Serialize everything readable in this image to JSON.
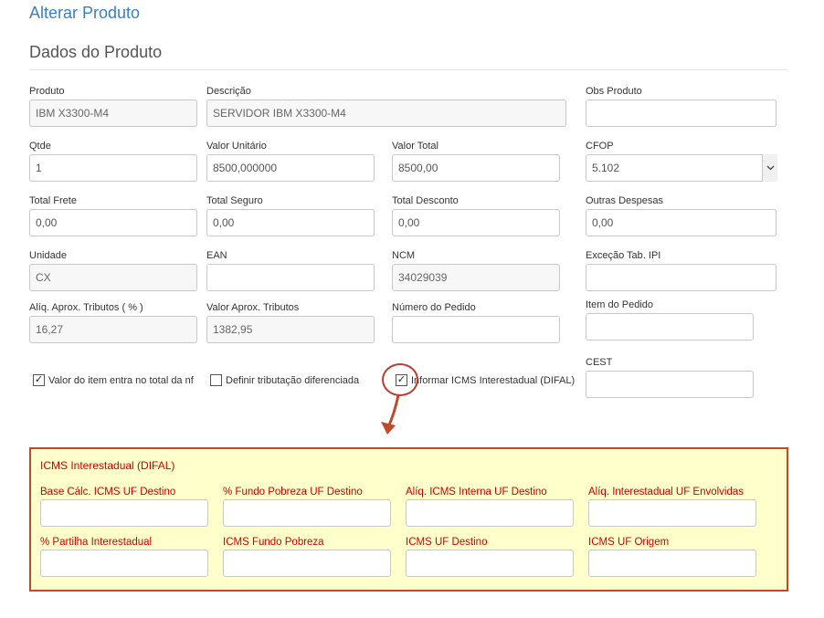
{
  "page": {
    "title": "Alterar Produto",
    "section": "Dados do Produto"
  },
  "fields": {
    "produto": {
      "label": "Produto",
      "value": "IBM X3300-M4"
    },
    "descricao": {
      "label": "Descrição",
      "value": "SERVIDOR IBM X3300-M4"
    },
    "obs_produto": {
      "label": "Obs Produto",
      "value": ""
    },
    "qtde": {
      "label": "Qtde",
      "value": "1"
    },
    "valor_unitario": {
      "label": "Valor Unitário",
      "value": "8500,000000"
    },
    "valor_total": {
      "label": "Valor Total",
      "value": "8500,00"
    },
    "cfop": {
      "label": "CFOP",
      "value": "5.102"
    },
    "total_frete": {
      "label": "Total Frete",
      "value": "0,00"
    },
    "total_seguro": {
      "label": "Total Seguro",
      "value": "0,00"
    },
    "total_desconto": {
      "label": "Total Desconto",
      "value": "0,00"
    },
    "outras_despesas": {
      "label": "Outras Despesas",
      "value": "0,00"
    },
    "unidade": {
      "label": "Unidade",
      "value": "CX"
    },
    "ean": {
      "label": "EAN",
      "value": ""
    },
    "ncm": {
      "label": "NCM",
      "value": "34029039"
    },
    "excecao_ipi": {
      "label": "Exceção Tab. IPI",
      "value": ""
    },
    "aliq_aprox": {
      "label": "Alíq. Aprox. Tributos ( % )",
      "value": "16,27"
    },
    "valor_aprox": {
      "label": "Valor Aprox. Tributos",
      "value": "1382,95"
    },
    "numero_pedido": {
      "label": "Número do Pedido",
      "value": ""
    },
    "item_pedido": {
      "label": "Item do Pedido",
      "value": ""
    },
    "cest": {
      "label": "CEST",
      "value": ""
    }
  },
  "checkboxes": {
    "valor_total_nf": {
      "label": "Valor do item entra no total da nf",
      "checked": true
    },
    "tributacao_diferenciada": {
      "label": "Definir tributação diferenciada",
      "checked": false
    },
    "icms_difal": {
      "label": "Informar ICMS Interestadual (DIFAL)",
      "checked": true
    }
  },
  "difal": {
    "title": "ICMS Interestadual (DIFAL)",
    "base_calc": {
      "label": "Base Cálc. ICMS UF Destino",
      "value": ""
    },
    "fundo_pobreza_pct": {
      "label": "% Fundo Pobreza UF Destino",
      "value": ""
    },
    "aliq_interna": {
      "label": "Alíq. ICMS Interna UF Destino",
      "value": ""
    },
    "aliq_interestadual": {
      "label": "Alíq. Interestadual UF Envolvidas",
      "value": ""
    },
    "partilha": {
      "label": "% Partilha Interestadual",
      "value": ""
    },
    "fundo_pobreza": {
      "label": "ICMS Fundo Pobreza",
      "value": ""
    },
    "uf_destino": {
      "label": "ICMS UF Destino",
      "value": ""
    },
    "uf_origem": {
      "label": "ICMS UF Origem",
      "value": ""
    }
  },
  "icons": {
    "select_arrow": "chevron-down-icon",
    "checkmark": "checkmark-icon"
  },
  "colors": {
    "title_blue": "#3a7fc1",
    "annotation_red": "#c0492b",
    "difal_bg": "#ffffcc",
    "difal_text": "#cc0000"
  }
}
